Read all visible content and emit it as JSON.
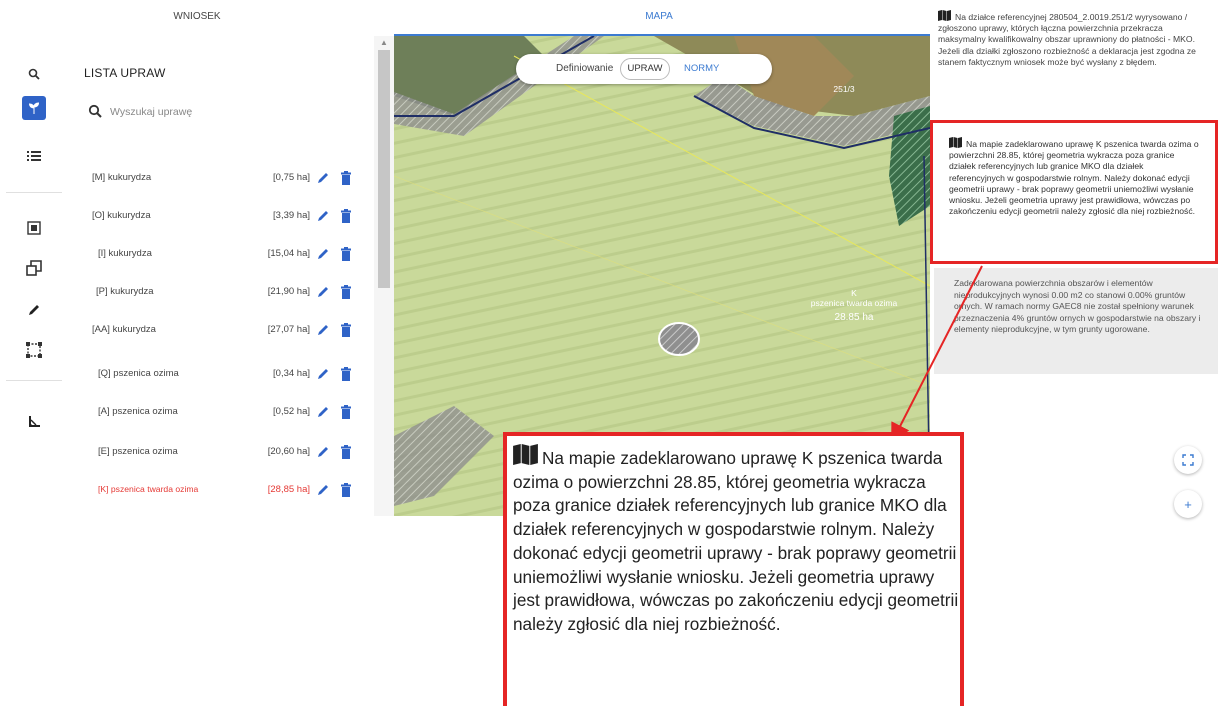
{
  "tabs": [
    {
      "label": "WNIOSEK"
    },
    {
      "label": "MAPA"
    }
  ],
  "rail_icons": [
    "search-icon",
    "plant-icon",
    "list-icon",
    "select-area-icon",
    "copy-shape-icon",
    "pencil-icon",
    "bounding-box-icon",
    "measure-angle-icon"
  ],
  "crop_list": {
    "title": "LISTA UPRAW",
    "search_placeholder": "Wyszukaj uprawę",
    "items": [
      {
        "name": "[M] kukurydza",
        "area": "[0,75 ha]"
      },
      {
        "name": "[O] kukurydza",
        "area": "[3,39 ha]"
      },
      {
        "name": "[I] kukurydza",
        "area": "[15,04 ha]"
      },
      {
        "name": "[P] kukurydza",
        "area": "[21,90 ha]"
      },
      {
        "name": "[AA] kukurydza",
        "area": "[27,07 ha]"
      },
      {
        "name": "[Q] pszenica ozima",
        "area": "[0,34 ha]"
      },
      {
        "name": "[A] pszenica ozima",
        "area": "[0,52 ha]"
      },
      {
        "name": "[E] pszenica ozima",
        "area": "[20,60 ha]"
      },
      {
        "name": "[K] pszenica twarda ozima",
        "area": "[28,85 ha]"
      }
    ],
    "highlight_color": "#e53935"
  },
  "map": {
    "toggle_label": "Definiowanie",
    "toggle_options": [
      "UPRAW",
      "NORMY"
    ],
    "parcel_label": "251/3",
    "crop_label_code": "K",
    "crop_label_name": "pszenica twarda ozima",
    "crop_label_area": "28.85 ha",
    "controls": [
      "fullscreen-icon",
      "zoom-in-icon"
    ]
  },
  "messages": {
    "msg1": "Na działce referencyjnej 280504_2.0019.251/2 wyrysowano / zgłoszono uprawy, których łączna powierzchnia przekracza maksymalny kwalifikowalny obszar uprawniony do płatności - MKO. Jeżeli dla działki zgłoszono rozbieżność a deklaracja jest zgodna ze stanem faktycznym wniosek może być wysłany z błędem.",
    "msg2": "Na mapie zadeklarowano uprawę K pszenica twarda ozima o powierzchni 28.85, której geometria wykracza poza granice działek referencyjnych lub granice MKO dla działek referencyjnych w gospodarstwie rolnym. Należy dokonać edycji geometrii uprawy - brak poprawy geometrii uniemożliwi wysłanie wniosku. Jeżeli geometria uprawy jest prawidłowa, wówczas po zakończeniu edycji geometrii należy zgłosić dla niej rozbieżność.",
    "msg3": "Zadeklarowana powierzchnia obszarów i elementów nieprodukcyjnych wynosi 0.00 m2 co stanowi 0.00% gruntów ornych. W ramach normy GAEC8 nie został spełniony warunek przeznaczenia 4% gruntów ornych w gospodarstwie na obszary i elementy nieprodukcyjne, w tym grunty ugorowane."
  },
  "accent_color": "#3c7bd1",
  "alert_color": "#e52525"
}
